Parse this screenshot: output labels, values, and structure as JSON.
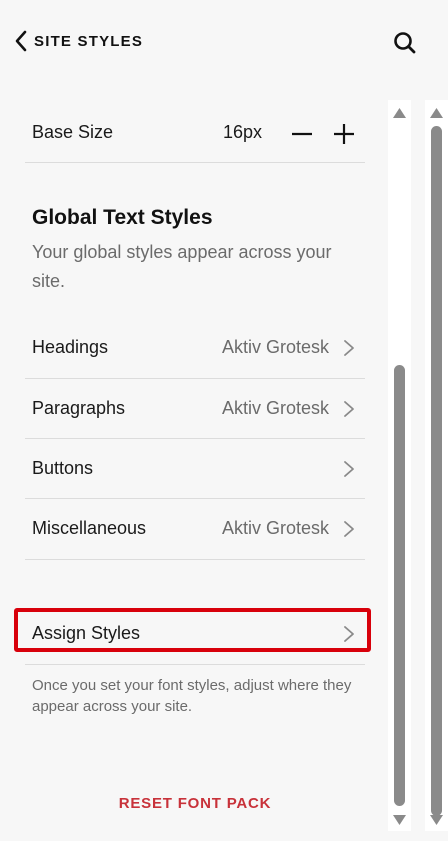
{
  "header": {
    "title": "SITE STYLES",
    "back_icon": "chevron-left-icon",
    "search_icon": "search-icon"
  },
  "base_size": {
    "label": "Base Size",
    "value": "16px"
  },
  "global_text_styles": {
    "title": "Global Text Styles",
    "description": "Your global styles appear across your site."
  },
  "styles": [
    {
      "label": "Headings",
      "value": "Aktiv Grotesk"
    },
    {
      "label": "Paragraphs",
      "value": "Aktiv Grotesk"
    },
    {
      "label": "Buttons",
      "value": ""
    },
    {
      "label": "Miscellaneous",
      "value": "Aktiv Grotesk"
    }
  ],
  "assign": {
    "label": "Assign Styles",
    "description": "Once you set your font styles, adjust where they appear across your site."
  },
  "reset_label": "RESET FONT PACK",
  "colors": {
    "highlight": "#d8000b",
    "reset": "#c8323a",
    "muted_text": "#6b6b6b"
  }
}
